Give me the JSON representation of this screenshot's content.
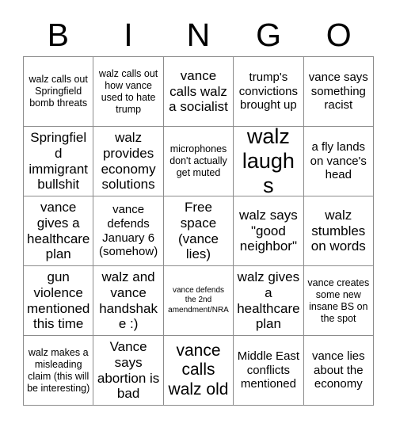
{
  "header": {
    "letters": [
      "B",
      "I",
      "N",
      "G",
      "O"
    ]
  },
  "grid": {
    "rows": 5,
    "columns": 5,
    "border_color": "#8c8c8c",
    "cell_background": "#ffffff",
    "text_color": "#000000",
    "cells": [
      {
        "text": "walz calls out Springfield bomb threats",
        "size": "sm"
      },
      {
        "text": "walz calls out how vance used to hate trump",
        "size": "sm"
      },
      {
        "text": "vance calls walz a socialist",
        "size": "lg"
      },
      {
        "text": "trump's convictions brought up",
        "size": "md"
      },
      {
        "text": "vance says something racist",
        "size": "md"
      },
      {
        "text": "Springfield immigrant bullshit",
        "size": "lg"
      },
      {
        "text": "walz provides economy solutions",
        "size": "lg"
      },
      {
        "text": "microphones don't actually get muted",
        "size": "sm"
      },
      {
        "text": "walz laughs",
        "size": "xxl"
      },
      {
        "text": "a fly lands on vance's head",
        "size": "md"
      },
      {
        "text": "vance gives a healthcare plan",
        "size": "lg"
      },
      {
        "text": "vance defends January 6 (somehow)",
        "size": "md"
      },
      {
        "text": "Free space (vance lies)",
        "size": "lg"
      },
      {
        "text": "walz says \"good neighbor\"",
        "size": "lg"
      },
      {
        "text": "walz stumbles on words",
        "size": "lg"
      },
      {
        "text": "gun violence mentioned this time",
        "size": "lg"
      },
      {
        "text": "walz and vance handshake :)",
        "size": "lg"
      },
      {
        "text": "vance defends the 2nd amendment/NRA",
        "size": "xs"
      },
      {
        "text": "walz gives a healthcare plan",
        "size": "lg"
      },
      {
        "text": "vance creates some new insane BS on the spot",
        "size": "sm"
      },
      {
        "text": "walz makes a misleading claim (this will be interesting)",
        "size": "sm"
      },
      {
        "text": "Vance says abortion is bad",
        "size": "lg"
      },
      {
        "text": "vance calls walz old",
        "size": "xl"
      },
      {
        "text": "Middle East conflicts mentioned",
        "size": "md"
      },
      {
        "text": "vance lies about the economy",
        "size": "md"
      }
    ]
  }
}
